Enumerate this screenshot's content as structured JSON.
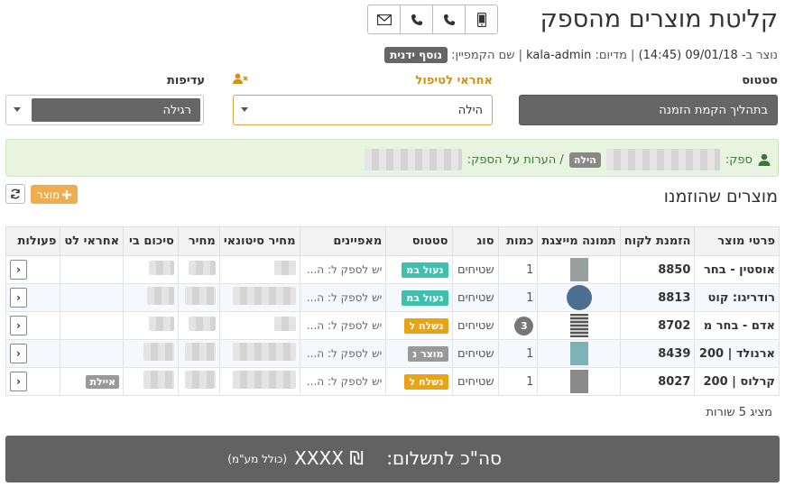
{
  "header": {
    "title": "קליטת מוצרים מהספק",
    "contact_icons": [
      "mail-icon",
      "phone-icon",
      "phone-icon",
      "mobile-icon"
    ]
  },
  "meta": {
    "created_prefix": "נוצר ב-",
    "created_date": "09/01/18 (14:45)",
    "medium_prefix": "| מדיום:",
    "medium_value": "kala-admin",
    "campaign_prefix": "| שם הקמפיין:",
    "campaign_value": "נוסף ידנית"
  },
  "fields": {
    "status_label": "סטטוס",
    "status_value": "בתהליך הקמת הזמנה",
    "handler_label": "אחראי לטיפול",
    "handler_value": "הילה",
    "priority_label": "עדיפות",
    "priority_value": "רגילה"
  },
  "supplier": {
    "label": "ספק:",
    "tag": "הילה",
    "notes_label": "/ הערות על הספק:"
  },
  "products": {
    "title": "מוצרים שהוזמנו",
    "add_label": "מוצר",
    "columns": [
      "פרטי מוצר",
      "הזמנת לקוח",
      "תמונה מייצגת",
      "כמות",
      "סוג",
      "סטטוס",
      "מאפיינים",
      "מחיר סיטונאי",
      "מחיר",
      "סיכום בי",
      "אחראי לט",
      "פעולות"
    ],
    "rows": [
      {
        "name": "אוסטין - בחר",
        "order": "8850",
        "qty": "1",
        "type": "שטיחים",
        "status": "נעול במ",
        "features": "יש לספק ל: ה...",
        "handler": "",
        "thumb_color": "#9aa0a0"
      },
      {
        "name": "רודריגו: קוט",
        "order": "8813",
        "qty": "1",
        "type": "שטיחים",
        "status": "נעול במ",
        "features": "יש לספק ל: ה...",
        "handler": "",
        "thumb_color": "#4d6f8f"
      },
      {
        "name": "אדם - בחר מ",
        "order": "8702",
        "qty": "3",
        "type": "שטיחים",
        "status": "נשלח ל",
        "features": "יש לספק ל: ה...",
        "handler": "",
        "thumb_color": "#777"
      },
      {
        "name": "ארנולד | 200",
        "order": "8439",
        "qty": "1",
        "type": "שטיחים",
        "status": "מוצר נ",
        "features": "יש לספק ל: ה...",
        "handler": "",
        "thumb_color": "#7fb1b8"
      },
      {
        "name": "קרלוס | 200",
        "order": "8027",
        "qty": "1",
        "type": "שטיחים",
        "status": "נשלח ל",
        "features": "יש לספק ל: ה...",
        "handler": "איילת",
        "thumb_color": "#8a8a8a"
      }
    ],
    "rows_count": "מציג 5 שורות"
  },
  "total": {
    "label": "סה\"כ לתשלום:",
    "amount": "₪ XXXX",
    "vat_note": "(כולל מע\"מ)"
  },
  "colors": {
    "status_green": "#3fbfae",
    "status_orange": "#e8a317",
    "status_gray": "#999999",
    "accent_orange": "#f0ad4e",
    "dark_gray": "#626262"
  }
}
